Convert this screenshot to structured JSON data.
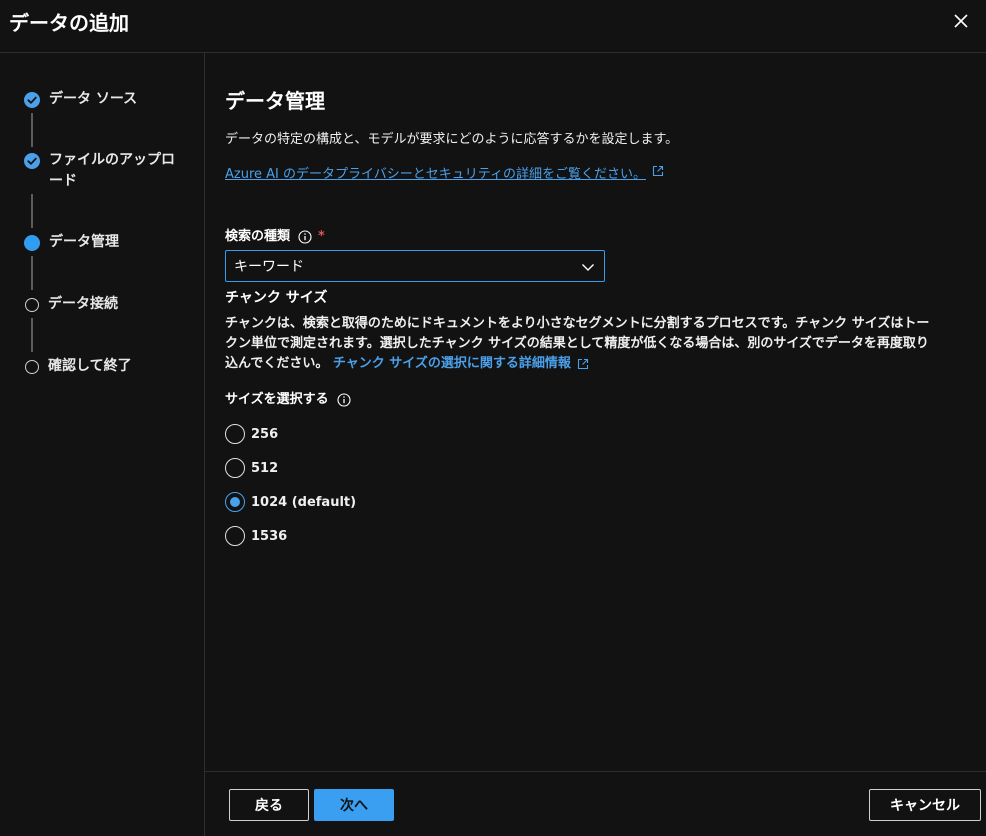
{
  "dialog": {
    "title": "データの追加",
    "close_icon": "close-icon"
  },
  "stepper": {
    "steps": [
      {
        "label": "データ ソース",
        "state": "done"
      },
      {
        "label": "ファイルのアップロード",
        "state": "done"
      },
      {
        "label": "データ管理",
        "state": "current"
      },
      {
        "label": "データ接続",
        "state": "todo"
      },
      {
        "label": "確認して終了",
        "state": "todo"
      }
    ]
  },
  "main": {
    "title": "データ管理",
    "description": "データの特定の構成と、モデルが要求にどのように応答するかを設定します。",
    "privacy_link": "Azure AI のデータプライバシーとセキュリティの詳細をご覧ください。",
    "search_type": {
      "label": "検索の種類",
      "required_mark": "*",
      "value": "キーワード"
    },
    "chunk_size": {
      "title": "チャンク サイズ",
      "desc_line1": "チャンクは、検索と取得のためにドキュメントをより小さなセグメントに分割するプロセスです。チャンク サイズはトー",
      "desc_line2": "クン単位で測定されます。選択したチャンク サイズの結果として精度が低くなる場合は、別のサイズでデータを再度取り",
      "desc_line3": "込んでください。",
      "link": "チャンク サイズの選択に関する詳細情報",
      "select_label": "サイズを選択する",
      "options": [
        {
          "label": "256",
          "checked": false
        },
        {
          "label": "512",
          "checked": false
        },
        {
          "label": "1024 (default)",
          "checked": true
        },
        {
          "label": "1536",
          "checked": false
        }
      ]
    }
  },
  "footer": {
    "back_label": "戻る",
    "next_label": "次へ",
    "cancel_label": "キャンセル"
  },
  "colors": {
    "background": "#121212",
    "accent": "#2f9ef0",
    "link": "#4ba0ea",
    "required": "#e05353"
  }
}
